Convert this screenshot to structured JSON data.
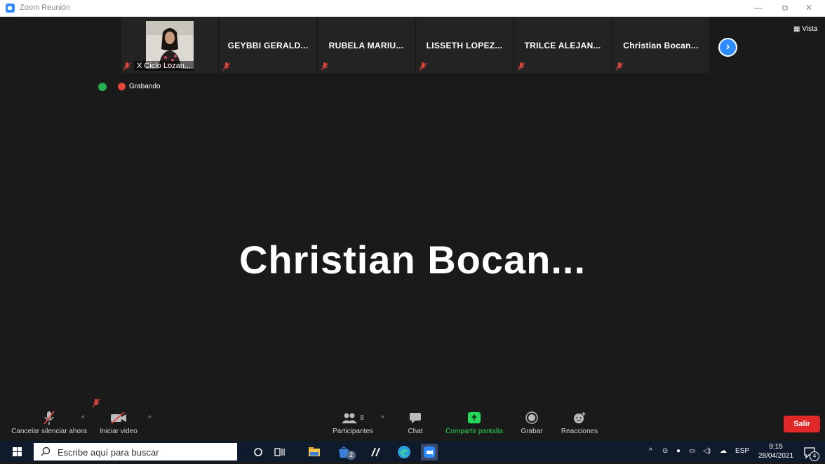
{
  "window": {
    "title": "Zoom Reunión",
    "minimize": "—",
    "restore": "⧉",
    "close": "✕"
  },
  "participants_strip": {
    "tiles": [
      {
        "name": "X Ciclo Lozan...",
        "has_video": true
      },
      {
        "name": "GEYBBI GERALD..."
      },
      {
        "name": "RUBELA MARIU..."
      },
      {
        "name": "LISSETH LOPEZ..."
      },
      {
        "name": "TRILCE ALEJAN..."
      },
      {
        "name": "Christian Bocan..."
      }
    ],
    "next_icon": "chevron-right-icon"
  },
  "view_button": {
    "label": "Vista"
  },
  "recording": {
    "label": "Grabando"
  },
  "active_speaker": {
    "name": "Christian  Bocan..."
  },
  "toolbar": {
    "mute_label": "Cancelar silenciar ahora",
    "video_label": "Iniciar video",
    "participants_label": "Participantes",
    "participants_count": "8",
    "chat_label": "Chat",
    "share_label": "Compartir pantalla",
    "record_label": "Grabar",
    "reactions_label": "Reacciones",
    "leave_label": "Salir",
    "share_color": "#23d959",
    "leave_color": "#e02828"
  },
  "taskbar": {
    "search_placeholder": "Escribe aquí para buscar",
    "store_badge": "2",
    "language": "ESP",
    "time": "9:15",
    "date": "28/04/2021",
    "notifications": "4"
  }
}
